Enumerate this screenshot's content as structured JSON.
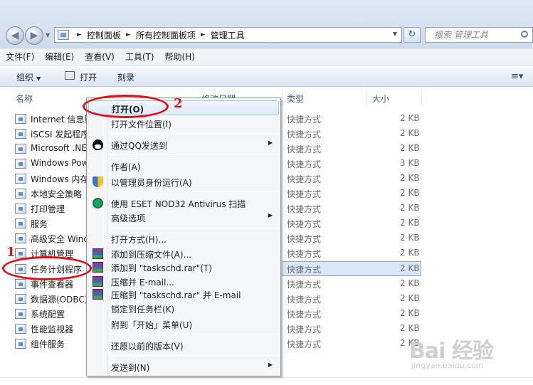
{
  "address": {
    "crumbs": [
      "控制面板",
      "所有控制面板项",
      "管理工具"
    ],
    "search_placeholder": "搜索 管理工具"
  },
  "menubar": [
    "文件(F)",
    "编辑(E)",
    "查看(V)",
    "工具(T)",
    "帮助(H)"
  ],
  "toolbar": {
    "organize": "组织",
    "open": "打开",
    "burn": "刻录"
  },
  "columns": {
    "name": "名称",
    "date": "修改日期",
    "type": "类型",
    "size": "大小"
  },
  "rows": [
    {
      "name": "Internet 信息服务",
      "type": "快捷方式",
      "size": "2 KB"
    },
    {
      "name": "iSCSI 发起程序",
      "type": "快捷方式",
      "size": "2 KB"
    },
    {
      "name": "Microsoft .NET",
      "type": "快捷方式",
      "size": "2 KB"
    },
    {
      "name": "Windows PowerShell",
      "type": "快捷方式",
      "size": "3 KB"
    },
    {
      "name": "Windows 内存诊断",
      "type": "快捷方式",
      "size": "2 KB"
    },
    {
      "name": "本地安全策略",
      "type": "快捷方式",
      "size": "2 KB"
    },
    {
      "name": "打印管理",
      "type": "快捷方式",
      "size": "2 KB"
    },
    {
      "name": "服务",
      "type": "快捷方式",
      "size": "2 KB"
    },
    {
      "name": "高级安全 Windows",
      "type": "快捷方式",
      "size": "2 KB"
    },
    {
      "name": "计算机管理",
      "type": "快捷方式",
      "size": "2 KB"
    },
    {
      "name": "任务计划程序",
      "type": "快捷方式",
      "size": "2 KB"
    },
    {
      "name": "事件查看器",
      "type": "快捷方式",
      "size": "2 KB"
    },
    {
      "name": "数据源(ODBC)",
      "type": "快捷方式",
      "size": "2 KB"
    },
    {
      "name": "系统配置",
      "type": "快捷方式",
      "size": "2 KB"
    },
    {
      "name": "性能监视器",
      "type": "快捷方式",
      "size": "2 KB"
    },
    {
      "name": "组件服务",
      "type": "快捷方式",
      "size": "2 KB"
    }
  ],
  "context_menu": [
    "打开(O)",
    "打开文件位置(I)",
    "通过QQ发送到",
    "作者(A)",
    "以管理员身份运行(A)",
    "使用 ESET NOD32 Antivirus 扫描",
    "高级选项",
    "打开方式(H)...",
    "添加到压缩文件(A)...",
    "添加到 \"taskschd.rar\"(T)",
    "压缩并 E-mail...",
    "压缩到 \"taskschd.rar\" 并 E-mail",
    "锁定到任务栏(K)",
    "附到「开始」菜单(U)",
    "还原以前的版本(V)",
    "发送到(N)"
  ],
  "annotations": {
    "step1": "1",
    "step2": "2"
  },
  "watermark": {
    "brand": "Bai 经验",
    "url": "jingyan.baidu.com"
  },
  "colors": {
    "annotation_red": "#e0101a",
    "selection": "#d8e8fb"
  }
}
